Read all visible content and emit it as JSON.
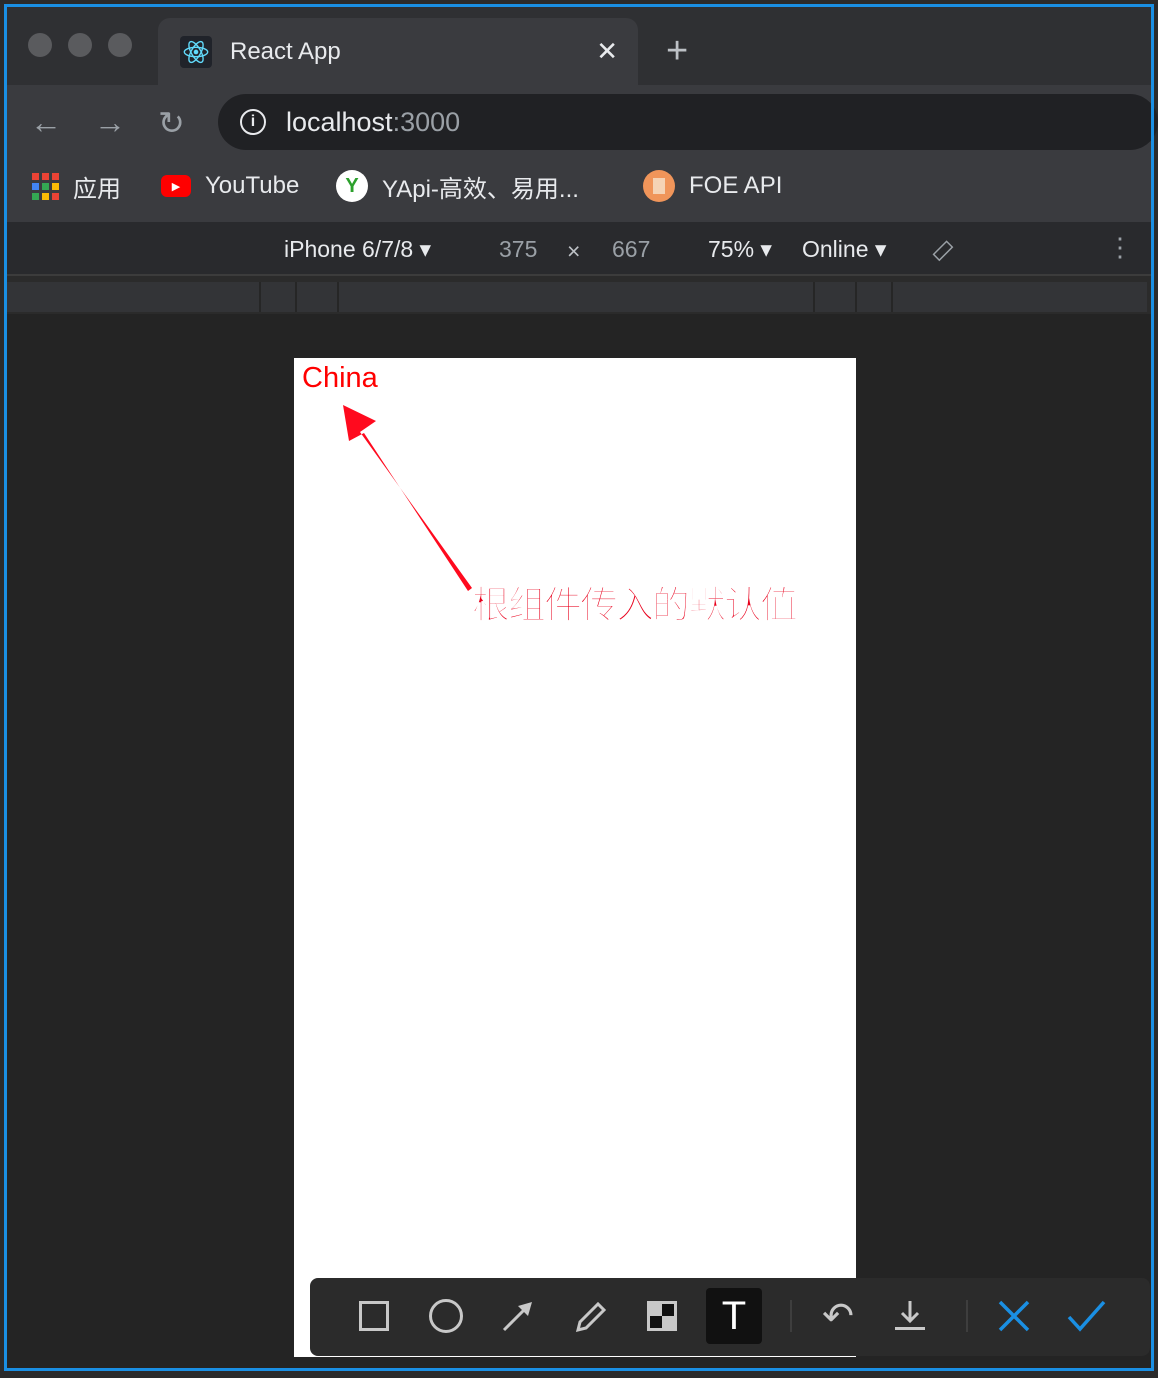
{
  "browser": {
    "tab": {
      "title": "React App",
      "icon": "react-icon"
    },
    "url": {
      "host": "localhost",
      "port": ":3000"
    },
    "bookmarks": [
      {
        "label": "应用",
        "icon": "apps-grid-icon"
      },
      {
        "label": "YouTube",
        "icon": "youtube-icon"
      },
      {
        "label": "YApi-高效、易用...",
        "icon": "yapi-icon"
      },
      {
        "label": "FOE API",
        "icon": "document-icon"
      }
    ]
  },
  "devtools": {
    "device": "iPhone 6/7/8",
    "width": "375",
    "times": "×",
    "height": "667",
    "zoom": "75%",
    "network": "Online"
  },
  "page": {
    "text": "China",
    "text_color": "#ff0000"
  },
  "annotation": {
    "text": "根组件传入的默认值",
    "color": "#e8001c"
  },
  "screenshot_toolbar": {
    "tools": [
      "rectangle",
      "ellipse",
      "arrow",
      "pencil",
      "mosaic",
      "text",
      "undo",
      "download",
      "cancel",
      "confirm"
    ],
    "active": "text",
    "accent": "#1a8fe3"
  }
}
